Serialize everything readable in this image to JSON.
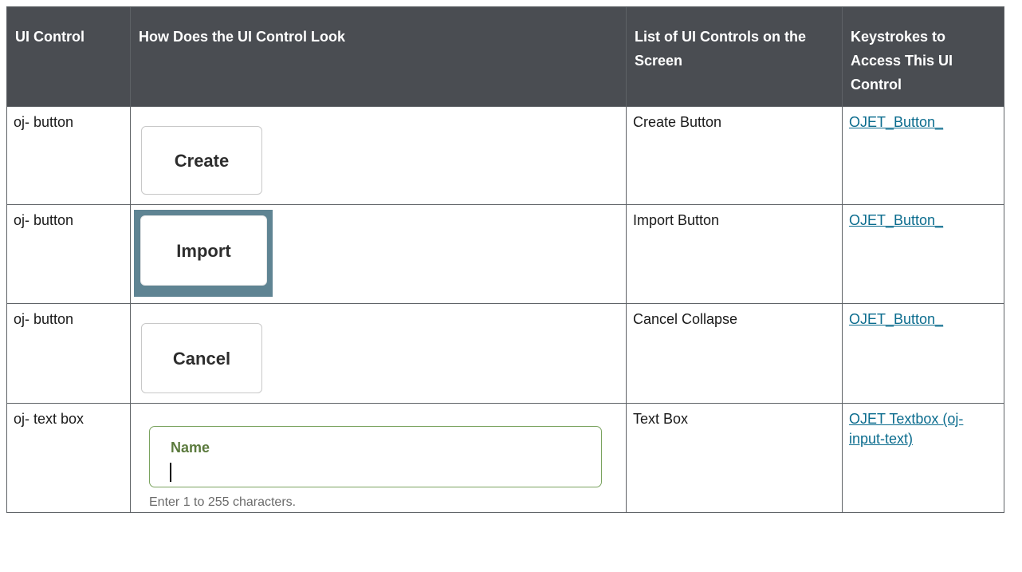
{
  "table": {
    "headers": [
      "UI Control",
      "How Does the UI Control Look",
      "List of UI Controls on the Screen",
      "Keystrokes to Access This UI Control"
    ],
    "rows": [
      {
        "control": "oj- button",
        "preview": {
          "kind": "button",
          "label": "Create"
        },
        "list": "Create Button",
        "link": "OJET_Button_"
      },
      {
        "control": "oj- button",
        "preview": {
          "kind": "button-focused",
          "label": "Import"
        },
        "list": "Import Button",
        "link": "OJET_Button_"
      },
      {
        "control": "oj- button",
        "preview": {
          "kind": "button",
          "label": "Cancel"
        },
        "list": "Cancel Collapse",
        "link": "OJET_Button_"
      },
      {
        "control": "oj- text box",
        "preview": {
          "kind": "textbox",
          "label": "Name",
          "hint": "Enter 1 to 255 characters."
        },
        "list": "Text Box",
        "link": "OJET Textbox (oj-input-text)"
      }
    ]
  },
  "colors": {
    "header_bg": "#4a4d52",
    "link": "#0b6c8e",
    "focus_ring": "#5f8493",
    "field_border": "#7aa35f"
  }
}
